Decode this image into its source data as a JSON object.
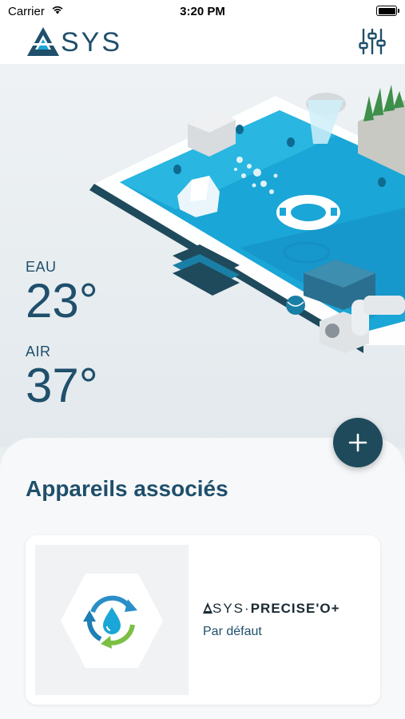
{
  "status": {
    "carrier": "Carrier",
    "time": "3:20 PM"
  },
  "header": {
    "logo_text": "SYS",
    "logo_icon": "asys-logo",
    "settings_icon": "sliders-icon"
  },
  "temperatures": {
    "water": {
      "label": "EAU",
      "value": "23°"
    },
    "air": {
      "label": "AIR",
      "value": "37°"
    }
  },
  "devices_section": {
    "title": "Appareils associés",
    "add_icon": "plus-icon",
    "devices": [
      {
        "brand": "SYS",
        "model": "PRECISE'O+",
        "subtitle": "Par défaut",
        "icon": "water-recycle-icon"
      }
    ]
  },
  "colors": {
    "primary": "#1f4f6b",
    "add_button": "#1e4a5c",
    "pool_water": "#1aa6d6"
  }
}
